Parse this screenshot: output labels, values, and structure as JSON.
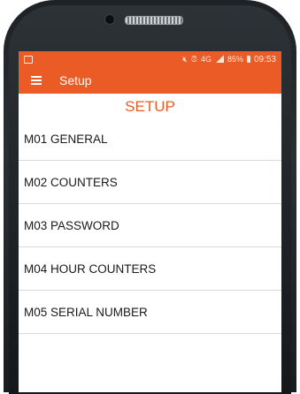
{
  "status_bar": {
    "battery_percent": "85%",
    "time": "09:53",
    "network": "4G"
  },
  "toolbar": {
    "title": "Setup"
  },
  "page": {
    "heading": "SETUP"
  },
  "menu": {
    "items": [
      {
        "label": "M01 GENERAL"
      },
      {
        "label": "M02 COUNTERS"
      },
      {
        "label": "M03 PASSWORD"
      },
      {
        "label": "M04 HOUR COUNTERS"
      },
      {
        "label": "M05 SERIAL NUMBER"
      }
    ]
  },
  "colors": {
    "accent": "#ea5b26",
    "bezel": "#1e2226"
  }
}
